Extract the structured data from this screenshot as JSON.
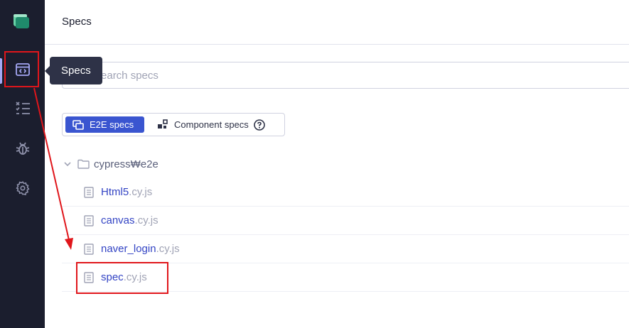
{
  "header": {
    "title": "Specs"
  },
  "sidebar": {
    "tooltip": "Specs"
  },
  "search": {
    "placeholder": "Search specs"
  },
  "toggle": {
    "e2e_label": "E2E specs",
    "component_label": "Component specs"
  },
  "tree": {
    "folder": "cypress₩e2e",
    "specs": [
      {
        "name": "Html5",
        "ext": ".cy.js"
      },
      {
        "name": "canvas",
        "ext": ".cy.js"
      },
      {
        "name": "naver_login",
        "ext": ".cy.js"
      },
      {
        "name": "spec",
        "ext": ".cy.js"
      }
    ]
  },
  "colors": {
    "sidebar_bg": "#1b1e2e",
    "accent": "#3a55d0",
    "link": "#3344c4",
    "annotation_red": "#e0161b"
  }
}
